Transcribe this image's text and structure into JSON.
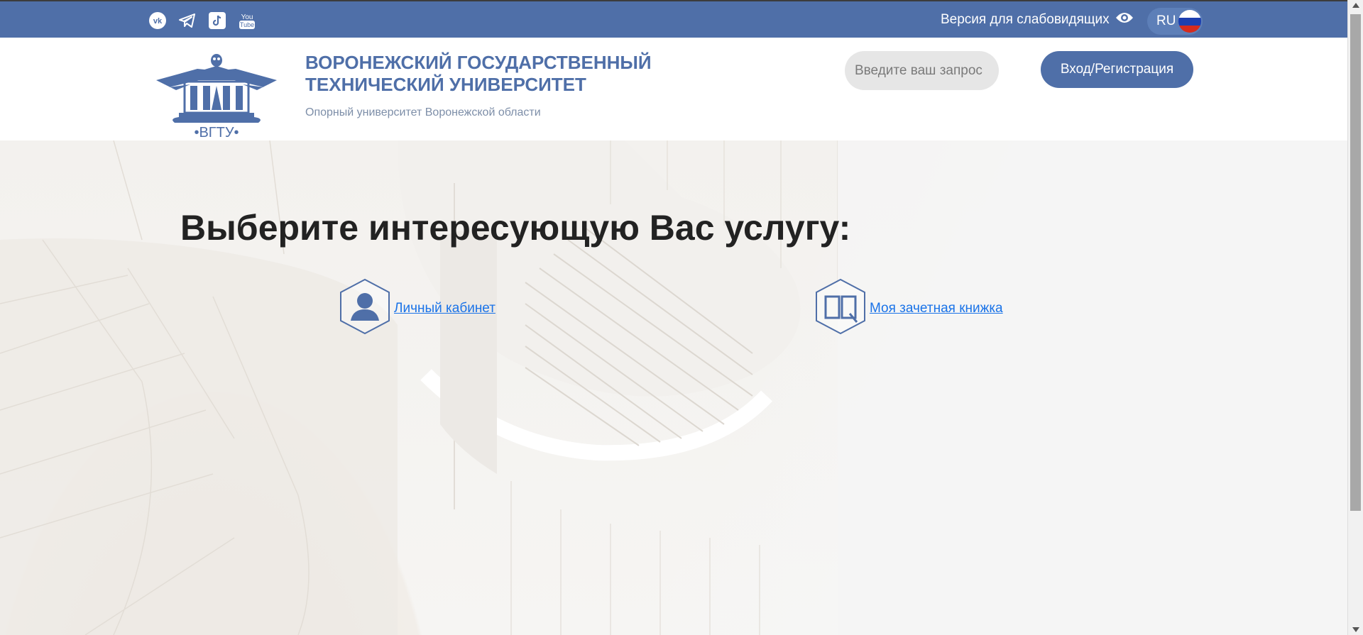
{
  "topbar": {
    "social": [
      {
        "name": "vk-icon"
      },
      {
        "name": "telegram-icon"
      },
      {
        "name": "tiktok-icon"
      },
      {
        "name": "youtube-icon",
        "label_top": "You",
        "label_bottom": "Tube"
      }
    ],
    "accessible_label": "Версия для слабовидящих",
    "lang": "RU"
  },
  "header": {
    "logo_text": "•ВГТУ•",
    "name_line1": "ВОРОНЕЖСКИЙ ГОСУДАРСТВЕННЫЙ",
    "name_line2": "ТЕХНИЧЕСКИЙ УНИВЕРСИТЕТ",
    "subtitle": "Опорный университет Воронежской области",
    "search_placeholder": "Введите ваш запрос",
    "login_label": "Вход/Регистрация"
  },
  "main": {
    "title": "Выберите интересующую Вас услугу:",
    "services": [
      {
        "label": "Личный кабинет",
        "icon": "user-icon"
      },
      {
        "label": "Моя зачетная книжка",
        "icon": "book-icon"
      }
    ]
  },
  "colors": {
    "brand": "#4f6fa8",
    "link": "#1a73e8"
  }
}
